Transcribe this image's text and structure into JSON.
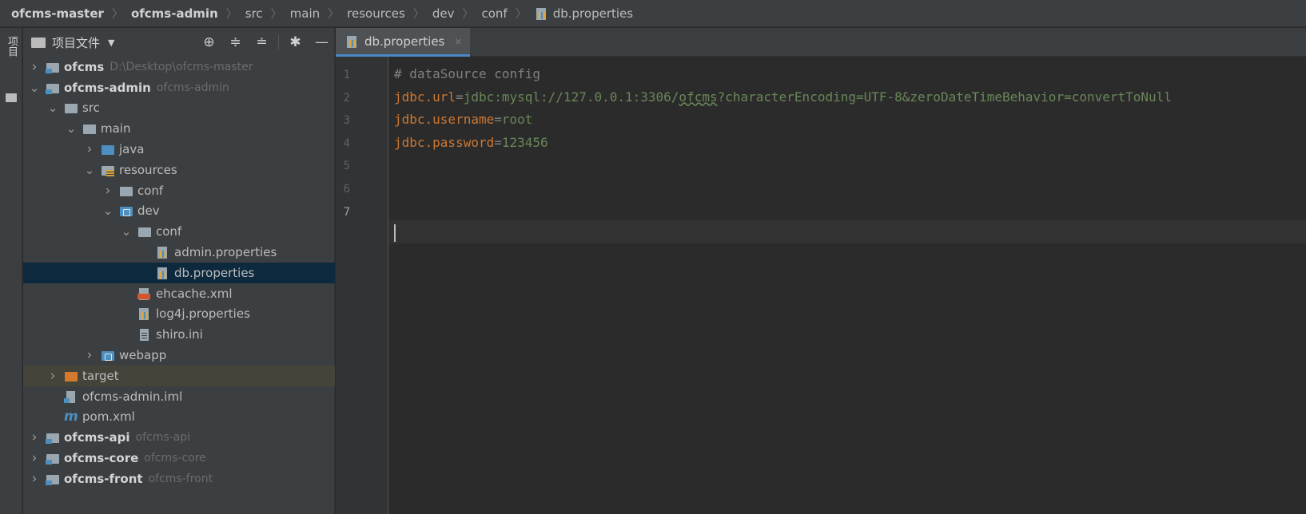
{
  "breadcrumb": {
    "items": [
      {
        "label": "ofcms-master",
        "bold": true
      },
      {
        "label": "ofcms-admin",
        "bold": true
      },
      {
        "label": "src",
        "bold": false
      },
      {
        "label": "main",
        "bold": false
      },
      {
        "label": "resources",
        "bold": false
      },
      {
        "label": "dev",
        "bold": false
      },
      {
        "label": "conf",
        "bold": false
      },
      {
        "label": "db.properties",
        "bold": false,
        "icon": "properties-file-icon"
      }
    ]
  },
  "toolstrip": {
    "label": "项目"
  },
  "project_panel": {
    "title": "项目文件",
    "dropdown_icon": "chevron-down-icon",
    "tools": [
      "locate-icon",
      "expand-all-icon",
      "collapse-all-icon",
      "gear-icon",
      "minimize-icon"
    ]
  },
  "tree": [
    {
      "name": "ofcms",
      "hint": "D:\\Desktop\\ofcms-master",
      "bold": true,
      "icon": "module",
      "arrow": "right",
      "depth": 0
    },
    {
      "name": "ofcms-admin",
      "hint": "ofcms-admin",
      "bold": true,
      "icon": "module",
      "arrow": "down",
      "depth": 0
    },
    {
      "name": "src",
      "hint": "",
      "bold": false,
      "icon": "folder",
      "arrow": "down",
      "depth": 1
    },
    {
      "name": "main",
      "hint": "",
      "bold": false,
      "icon": "folder",
      "arrow": "down",
      "depth": 2
    },
    {
      "name": "java",
      "hint": "",
      "bold": false,
      "icon": "folder-blue",
      "arrow": "right",
      "depth": 3
    },
    {
      "name": "resources",
      "hint": "",
      "bold": false,
      "icon": "folder-res",
      "arrow": "down",
      "depth": 3
    },
    {
      "name": "conf",
      "hint": "",
      "bold": false,
      "icon": "folder",
      "arrow": "right",
      "depth": 4
    },
    {
      "name": "dev",
      "hint": "",
      "bold": false,
      "icon": "folder-dev",
      "arrow": "down",
      "depth": 4
    },
    {
      "name": "conf",
      "hint": "",
      "bold": false,
      "icon": "folder",
      "arrow": "down",
      "depth": 5
    },
    {
      "name": "admin.properties",
      "hint": "",
      "bold": false,
      "icon": "props",
      "arrow": "none",
      "depth": 6
    },
    {
      "name": "db.properties",
      "hint": "",
      "bold": false,
      "icon": "props",
      "arrow": "none",
      "depth": 6,
      "selected": true
    },
    {
      "name": "ehcache.xml",
      "hint": "",
      "bold": false,
      "icon": "xml",
      "arrow": "none",
      "depth": 5
    },
    {
      "name": "log4j.properties",
      "hint": "",
      "bold": false,
      "icon": "props",
      "arrow": "none",
      "depth": 5
    },
    {
      "name": "shiro.ini",
      "hint": "",
      "bold": false,
      "icon": "ini",
      "arrow": "none",
      "depth": 5
    },
    {
      "name": "webapp",
      "hint": "",
      "bold": false,
      "icon": "folder-dev",
      "arrow": "right",
      "depth": 3
    },
    {
      "name": "target",
      "hint": "",
      "bold": false,
      "icon": "folder-orange",
      "arrow": "right",
      "depth": 1,
      "excluded": true
    },
    {
      "name": "ofcms-admin.iml",
      "hint": "",
      "bold": false,
      "icon": "iml",
      "arrow": "none",
      "depth": 1
    },
    {
      "name": "pom.xml",
      "hint": "",
      "bold": false,
      "icon": "maven",
      "arrow": "none",
      "depth": 1
    },
    {
      "name": "ofcms-api",
      "hint": "ofcms-api",
      "bold": true,
      "icon": "module",
      "arrow": "right",
      "depth": 0
    },
    {
      "name": "ofcms-core",
      "hint": "ofcms-core",
      "bold": true,
      "icon": "module",
      "arrow": "right",
      "depth": 0
    },
    {
      "name": "ofcms-front",
      "hint": "ofcms-front",
      "bold": true,
      "icon": "module",
      "arrow": "right",
      "depth": 0
    }
  ],
  "editor": {
    "tab": {
      "label": "db.properties",
      "close": "×"
    },
    "line_numbers": [
      "1",
      "2",
      "3",
      "4",
      "5",
      "6",
      "7"
    ],
    "current_line": 7,
    "lines": [
      {
        "comment": "# dataSource config"
      },
      {
        "key": "jdbc.url",
        "eq": "=",
        "value_pre": "jdbc:mysql://127.0.0.1:3306/",
        "value_underline": "ofcms",
        "value_post": "?characterEncoding=UTF-8&zeroDateTimeBehavior=convertToNull"
      },
      {
        "key": "jdbc.username",
        "eq": "=",
        "value_pre": "root",
        "value_underline": "",
        "value_post": ""
      },
      {
        "key": "jdbc.password",
        "eq": "=",
        "value_pre": "123456",
        "value_underline": "",
        "value_post": ""
      },
      {},
      {},
      {}
    ]
  }
}
